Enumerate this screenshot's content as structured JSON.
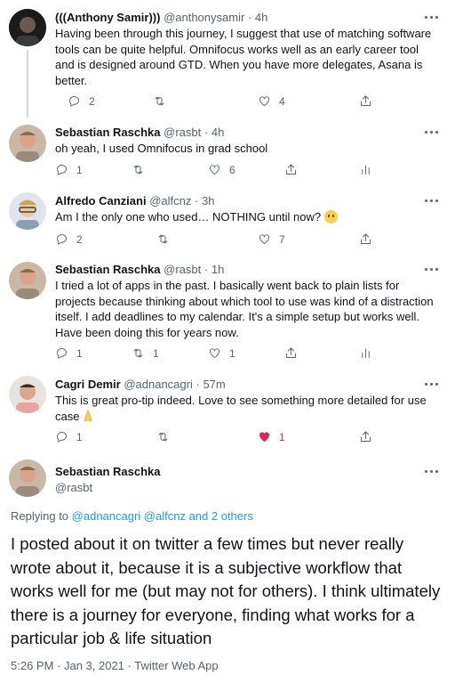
{
  "tweets": [
    {
      "name": "(((Anthony Samir)))",
      "handle": "@anthonysamir",
      "time": "4h",
      "text": "Having been through this journey, I suggest that use of matching software tools can be quite helpful. Omnifocus works well as an early career tool and is designed around GTD. When you have more delegates, Asana is better.",
      "replies": "2",
      "retweets": "",
      "likes": "4"
    },
    {
      "name": "Sebastian Raschka",
      "handle": "@rasbt",
      "time": "4h",
      "text": "oh yeah, I used Omnifocus in grad school",
      "replies": "1",
      "retweets": "",
      "likes": "6"
    },
    {
      "name": "Alfredo Canziani",
      "handle": "@alfcnz",
      "time": "3h",
      "text": "Am I the only one who used… NOTHING until now?",
      "replies": "2",
      "retweets": "",
      "likes": "7"
    },
    {
      "name": "Sebastian Raschka",
      "handle": "@rasbt",
      "time": "1h",
      "text": "I tried a lot of apps in the past. I basically went back to plain lists for projects because thinking about which tool to use was kind of a distraction itself. I add deadlines to my calendar. It's a simple setup but works well. Have been doing this for years now.",
      "replies": "1",
      "retweets": "1",
      "likes": "1"
    },
    {
      "name": "Cagri Demir",
      "handle": "@adnancagri",
      "time": "57m",
      "text": "This is great pro-tip indeed. Love to see something more detailed for use case",
      "replies": "1",
      "retweets": "",
      "likes": "1"
    }
  ],
  "focal": {
    "name": "Sebastian Raschka",
    "handle": "@rasbt",
    "replying_prefix": "Replying to",
    "replying_links": "@adnancagri @alfcnz and 2 others",
    "text": "I posted about it on twitter a few times but never really wrote about it, because it is a subjective workflow that works well for me (but may not for others). I think ultimately there is a journey for everyone, finding what works for a particular job & life situation",
    "meta": "5:26 PM · Jan 3, 2021 · Twitter Web App"
  },
  "separator": "·",
  "colors": {
    "accent": "#1d9bf0",
    "like_active": "#e0245e",
    "secondary_text": "#536471"
  },
  "icons": [
    "reply-icon",
    "retweet-icon",
    "like-icon",
    "share-icon",
    "analytics-icon",
    "more-icon"
  ]
}
